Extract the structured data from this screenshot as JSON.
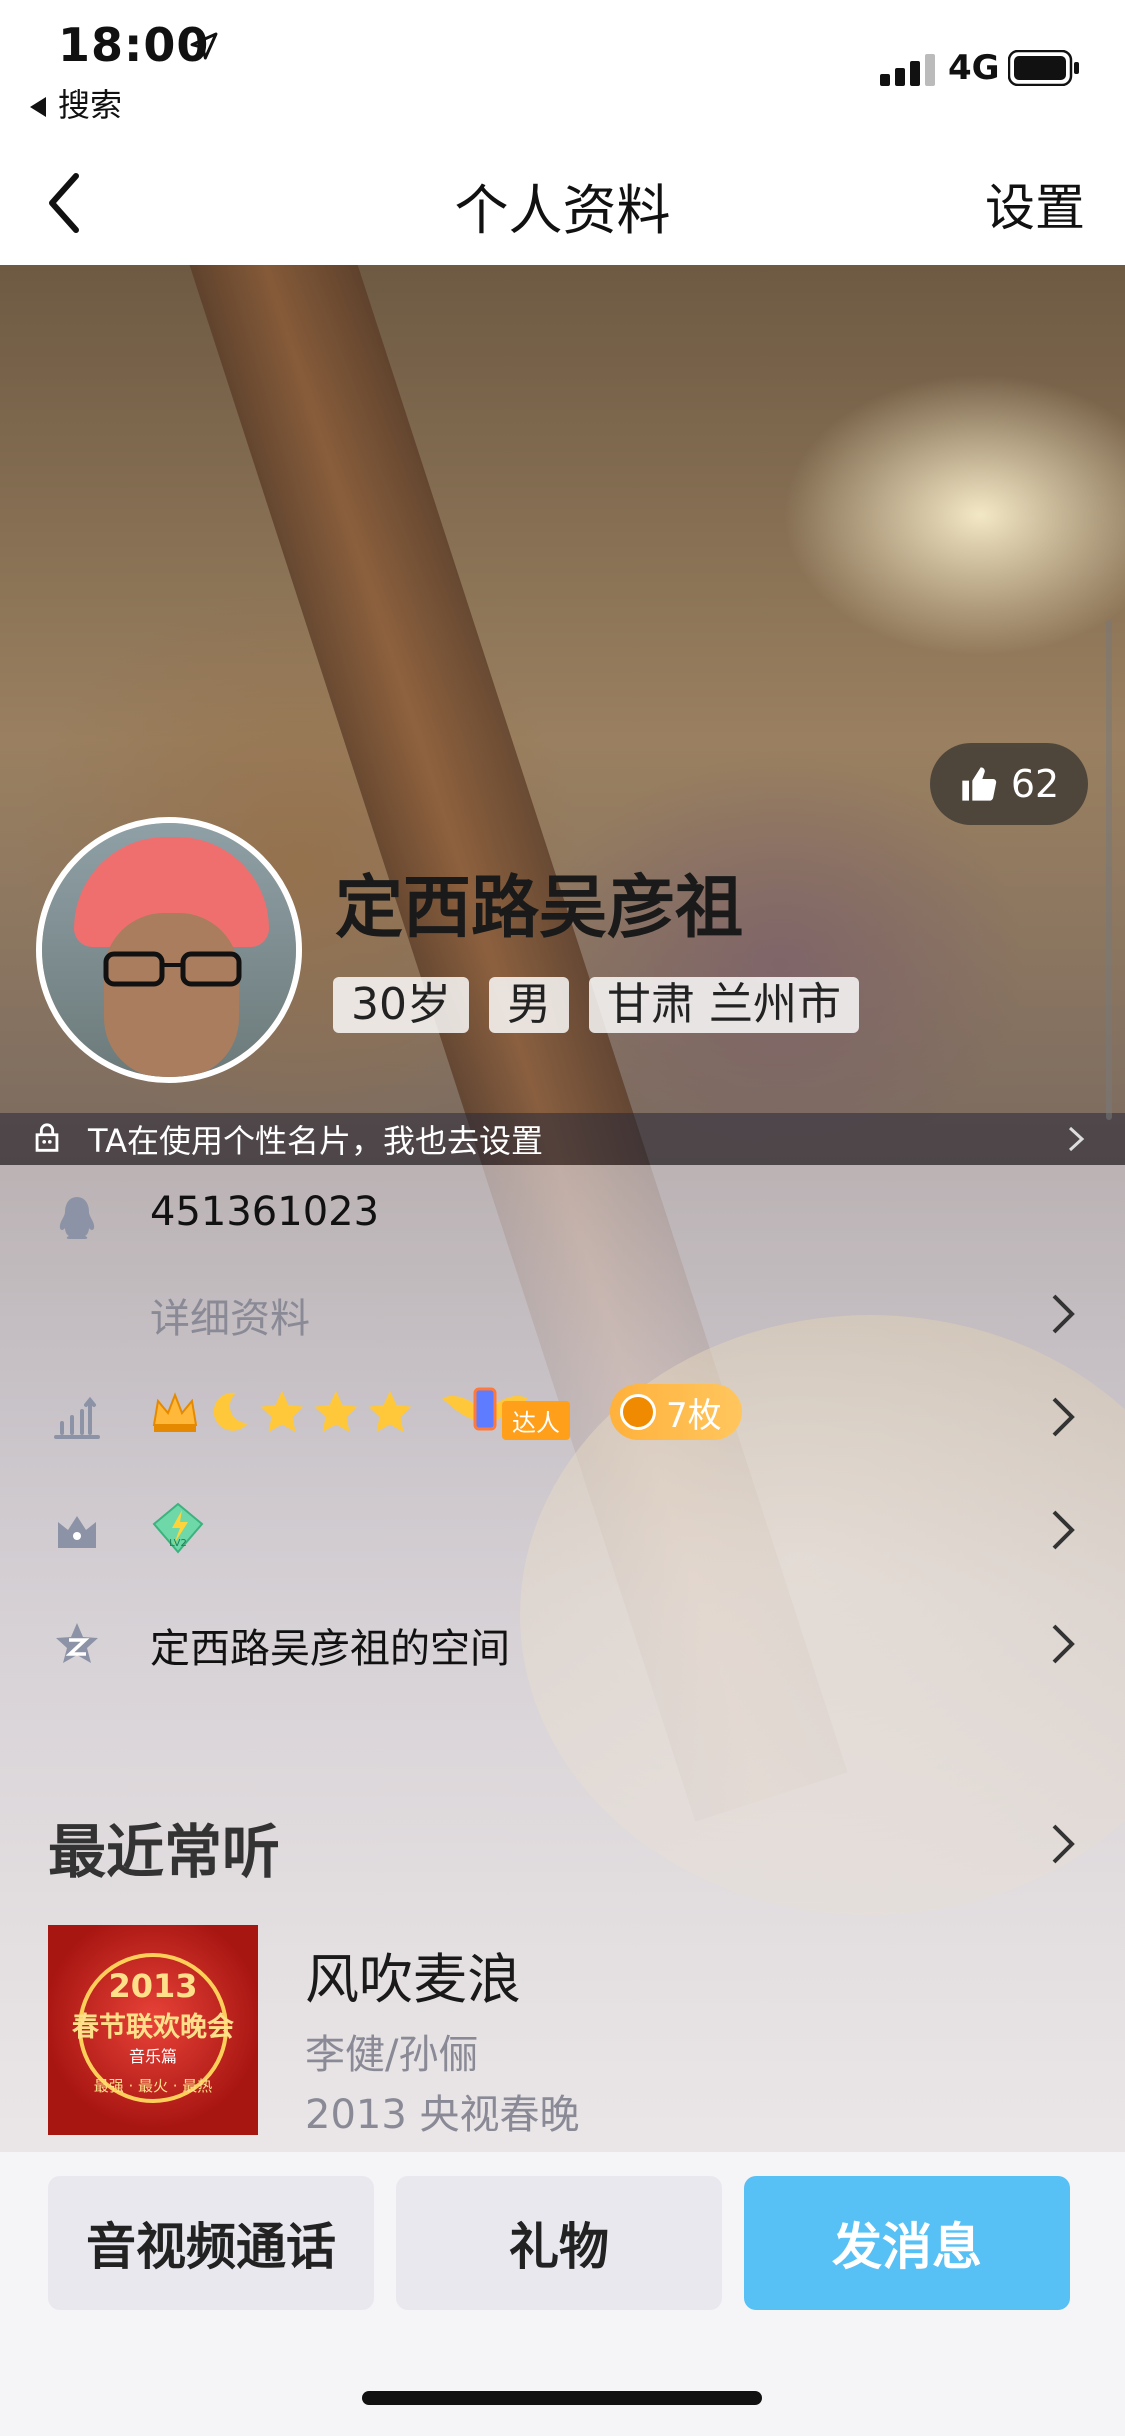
{
  "status_bar": {
    "time": "18:00",
    "back_app": "搜索",
    "network": "4G"
  },
  "nav": {
    "title": "个人资料",
    "settings": "设置"
  },
  "profile": {
    "likes": "62",
    "name": "定西路吴彦祖",
    "tags": [
      "30岁",
      "男",
      "甘肃 兰州市"
    ],
    "card_hint": "TA在使用个性名片，我也去设置"
  },
  "rows": {
    "qq_number": "451361023",
    "details_label": "详细资料",
    "talent_label": "达人",
    "medal_count": "7枚",
    "live_badge": "LV2",
    "space_label": "定西路吴彦祖的空间"
  },
  "music": {
    "section_title": "最近常听",
    "song": "风吹麦浪",
    "artist": "李健/孙俪",
    "album": "2013 央视春晚",
    "cover_year": "2013",
    "cover_title": "春节联欢晚会",
    "cover_sub": "音乐篇",
    "cover_foot": "最强 · 最火 · 最热"
  },
  "actions": {
    "call": "音视频通话",
    "gift": "礼物",
    "message": "发消息"
  },
  "colors": {
    "accent_blue": "#57c0f5",
    "medal_orange": "#ffb13b",
    "grey_button": "#e8e8ee"
  },
  "icons": [
    "location-arrow-icon",
    "signal-icon",
    "battery-icon",
    "back-chevron-icon",
    "thumbs-up-icon",
    "card-icon",
    "penguin-icon",
    "level-icon",
    "vip-icon",
    "qzone-icon",
    "chevron-right-icon"
  ]
}
